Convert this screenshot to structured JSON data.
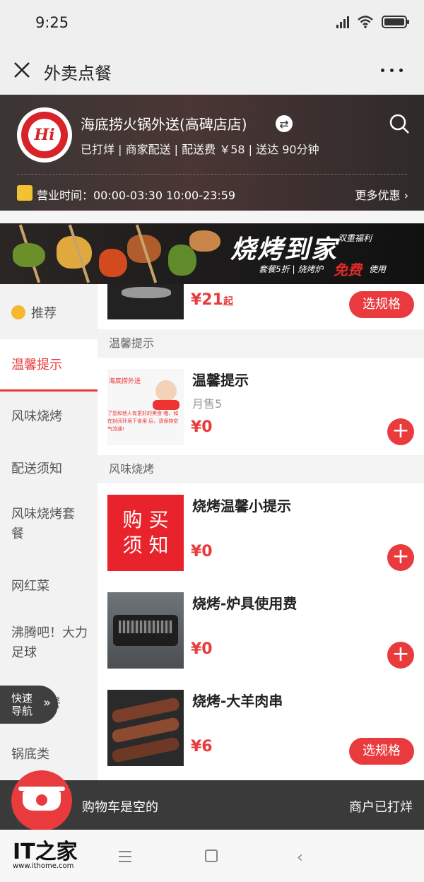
{
  "status_bar": {
    "time": "9:25"
  },
  "title_bar": {
    "title": "外卖点餐"
  },
  "store": {
    "name": "海底捞火锅外送(高碑店店)",
    "info": "已打烊 | 商家配送 | 配送费 ￥58 | 送达 90分钟",
    "hours": "营业时间：00:00-03:30 10:00-23:59",
    "more_deals": "更多优惠 ›",
    "logo_text": "Hi"
  },
  "banner": {
    "title": "烧烤到家",
    "subtitle": "双重福利",
    "line1": "套餐5折 | 烧烤炉",
    "free": "免费",
    "use": "使用"
  },
  "sidebar": {
    "items": [
      {
        "label": "推荐"
      },
      {
        "label": "温馨提示"
      },
      {
        "label": "风味烧烤"
      },
      {
        "label": "配送须知"
      },
      {
        "label": "风味烧烤套餐"
      },
      {
        "label": "网红菜"
      },
      {
        "label": "沸腾吧！大力足球"
      },
      {
        "label": "套餐"
      },
      {
        "label": "锅底类"
      }
    ]
  },
  "quick_nav": {
    "label": "快速导航",
    "chevron": "»"
  },
  "menu": {
    "top_item": {
      "price": "¥21",
      "price_suffix": "起",
      "button": "选规格"
    },
    "sections": [
      {
        "title": "温馨提示",
        "items": [
          {
            "name": "温馨提示",
            "sold": "月售5",
            "price": "¥0",
            "image_brand": "海底捞外送",
            "image_text": "了您和他人有更好的美食 嗑，如在封闭环境下食用 后，请保持空气流通!"
          }
        ]
      },
      {
        "title": "风味烧烤",
        "items": [
          {
            "name": "烧烤温馨小提示",
            "price": "¥0",
            "image_text": "购 买 须 知"
          },
          {
            "name": "烧烤-炉具使用费",
            "price": "¥0"
          },
          {
            "name": "烧烤-大羊肉串",
            "price": "¥6",
            "button": "选规格"
          }
        ]
      }
    ]
  },
  "cart": {
    "empty_text": "购物车是空的",
    "merchant_status": "商户已打烊"
  },
  "watermark": {
    "mark": "IT之家",
    "url": "www.ithome.com"
  },
  "colors": {
    "accent": "#e93b3d",
    "header_bg": "#3b3534",
    "cart_bg": "#3a3a3a"
  }
}
